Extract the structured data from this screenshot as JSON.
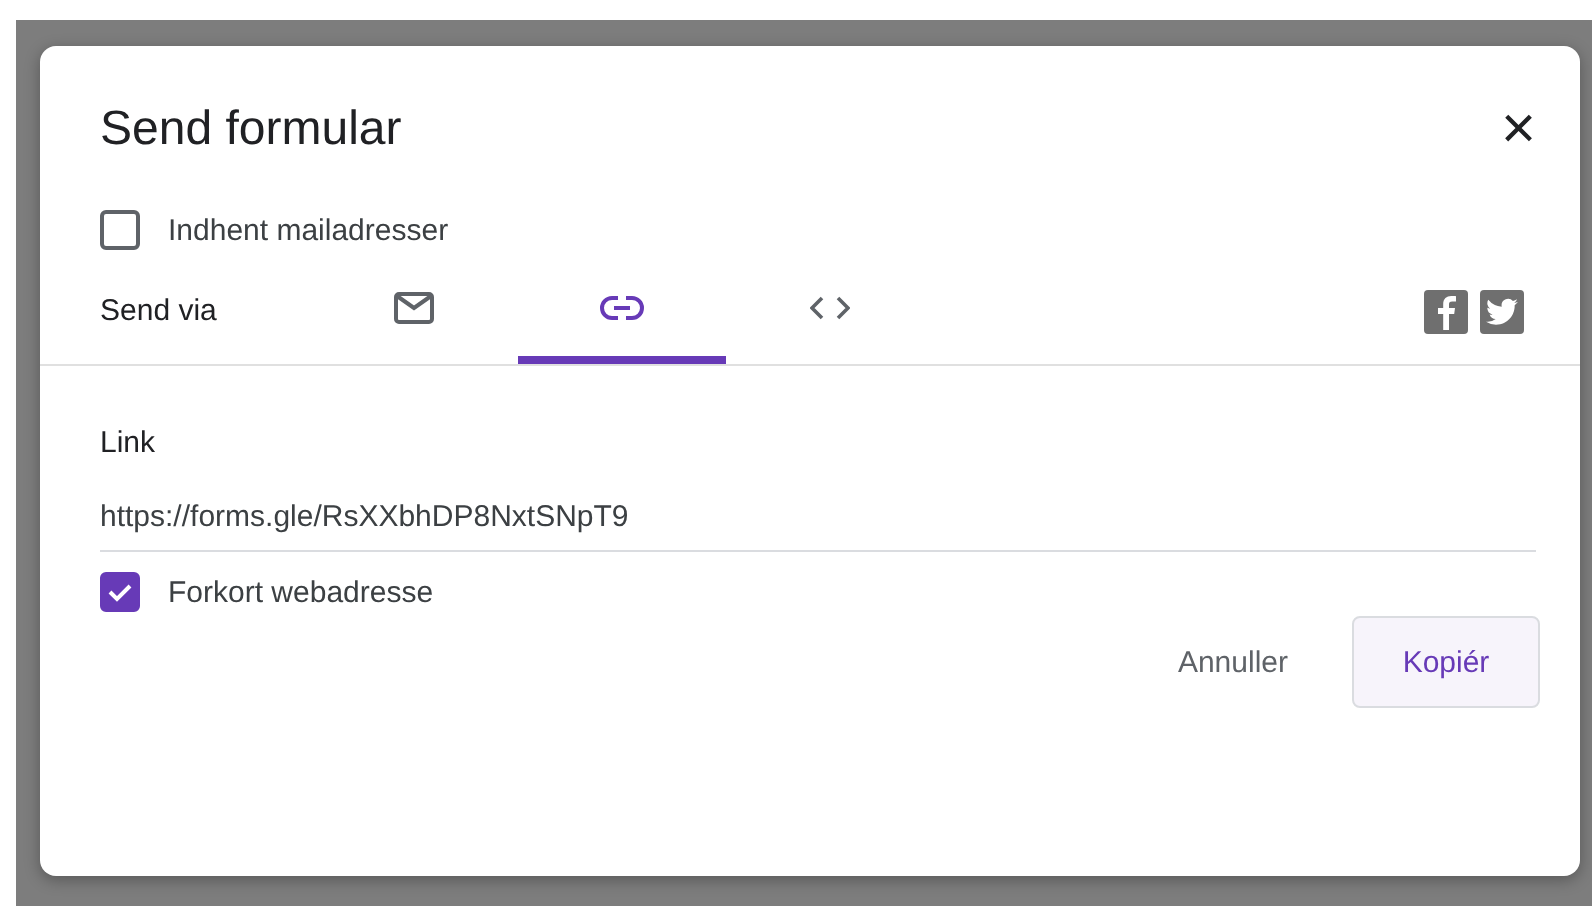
{
  "dialog": {
    "title": "Send formular",
    "close": "×"
  },
  "collect_emails": {
    "label": "Indhent mailadresser",
    "checked": false
  },
  "send_via": {
    "label": "Send via",
    "tabs": [
      {
        "kind": "email",
        "selected": false
      },
      {
        "kind": "link",
        "selected": true
      },
      {
        "kind": "embed",
        "selected": false
      }
    ],
    "share": [
      {
        "kind": "facebook"
      },
      {
        "kind": "twitter"
      }
    ]
  },
  "link": {
    "heading": "Link",
    "value": "https://forms.gle/RsXXbhDP8NxtSNpT9"
  },
  "shorten_url": {
    "label": "Forkort webadresse",
    "checked": true
  },
  "buttons": [
    {
      "kind": "text",
      "label": "Annuller"
    },
    {
      "kind": "primary",
      "label": "Kopiér"
    }
  ]
}
